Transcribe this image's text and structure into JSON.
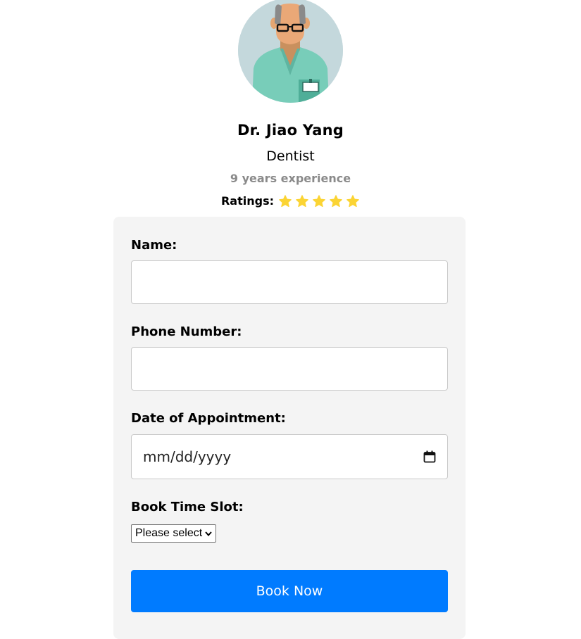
{
  "doctor": {
    "name": "Dr. Jiao Yang",
    "specialty": "Dentist",
    "experience": "9 years experience",
    "ratings_label": "Ratings:",
    "rating": 5,
    "rating_max": 5,
    "avatar_icon": "doctor-avatar-icon"
  },
  "form": {
    "name_label": "Name:",
    "name_value": "",
    "phone_label": "Phone Number:",
    "phone_value": "",
    "date_label": "Date of Appointment:",
    "date_placeholder": "mm/dd/yyyy",
    "date_icon": "calendar-icon",
    "slot_label": "Book Time Slot:",
    "slot_selected": "Please select",
    "submit_label": "Book Now"
  },
  "colors": {
    "star": "#fbd434",
    "button": "#007bff",
    "card_bg": "#f4f4f4",
    "experience_text": "#8a8a8a"
  }
}
